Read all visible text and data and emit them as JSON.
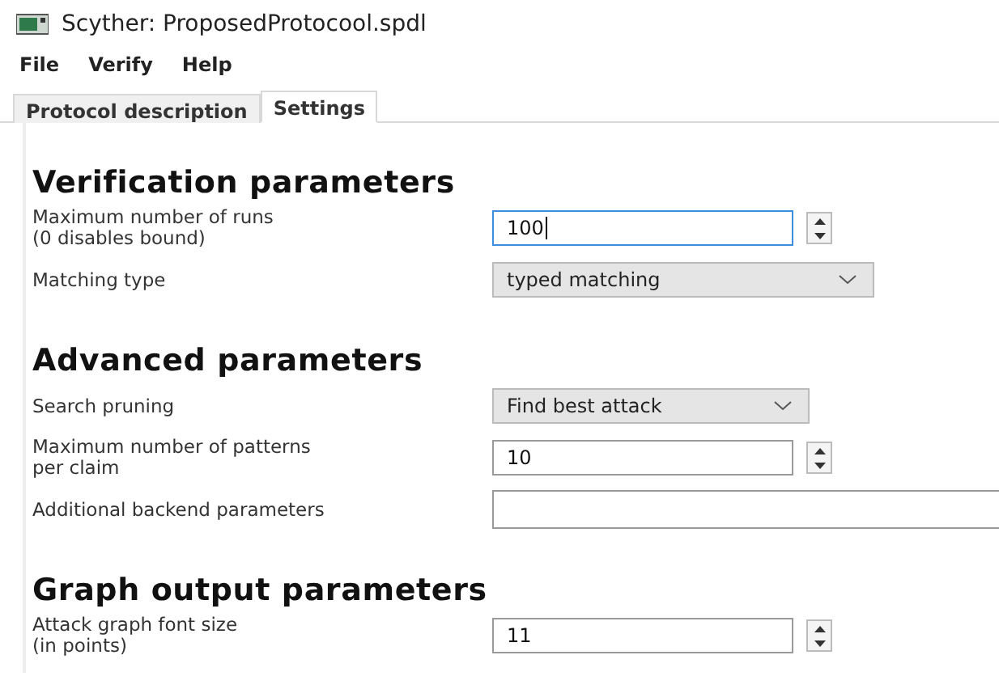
{
  "window": {
    "title": "Scyther: ProposedProtocool.spdl"
  },
  "menu": [
    "File",
    "Verify",
    "Help"
  ],
  "tabs": [
    {
      "label": "Protocol description",
      "selected": false
    },
    {
      "label": "Settings",
      "selected": true
    }
  ],
  "sections": [
    {
      "title": "Verification parameters",
      "fields": [
        {
          "kind": "spin",
          "label": "Maximum number of runs\n(0 disables bound)",
          "value": "100",
          "focused": true
        },
        {
          "kind": "select",
          "label": "Matching type",
          "value": "typed matching"
        }
      ]
    },
    {
      "title": "Advanced parameters",
      "fields": [
        {
          "kind": "select",
          "label": "Search pruning",
          "value": "Find best attack"
        },
        {
          "kind": "spin",
          "label": "Maximum number of patterns\nper claim",
          "value": "10",
          "focused": false
        },
        {
          "kind": "text",
          "label": "Additional backend parameters"
        }
      ]
    },
    {
      "title": "Graph output parameters",
      "fields": [
        {
          "kind": "spin",
          "label": "Attack graph font size\n(in points)",
          "value": "11",
          "focused": false
        }
      ]
    }
  ]
}
